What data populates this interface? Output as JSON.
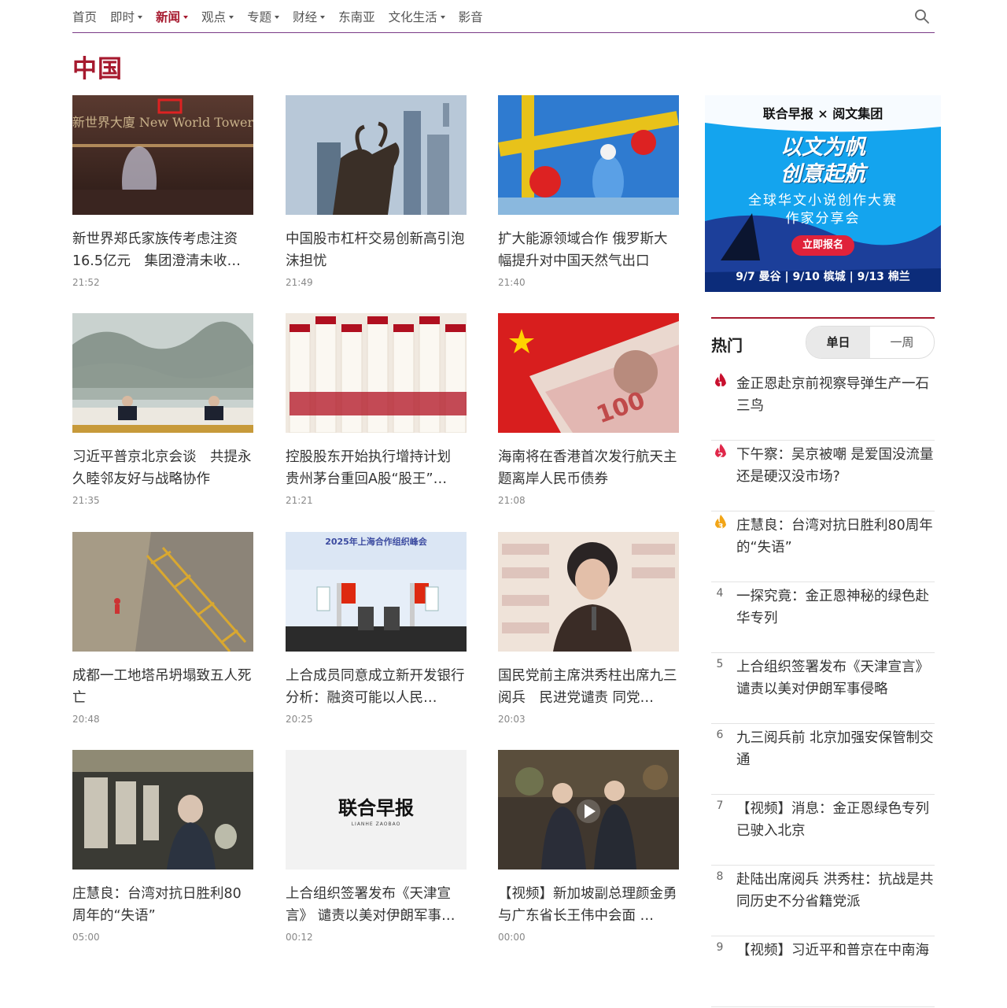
{
  "nav": {
    "items": [
      {
        "label": "首页",
        "caret": false,
        "active": false
      },
      {
        "label": "即时",
        "caret": true,
        "active": false
      },
      {
        "label": "新闻",
        "caret": true,
        "active": true
      },
      {
        "label": "观点",
        "caret": true,
        "active": false
      },
      {
        "label": "专题",
        "caret": true,
        "active": false
      },
      {
        "label": "财经",
        "caret": true,
        "active": false
      },
      {
        "label": "东南亚",
        "caret": false,
        "active": false
      },
      {
        "label": "文化生活",
        "caret": true,
        "active": false
      },
      {
        "label": "影音",
        "caret": false,
        "active": false
      }
    ],
    "search_icon": "search-icon"
  },
  "page": {
    "title": "中国"
  },
  "articles": [
    {
      "title": "新世界郑氏家族传考虑注资16.5亿元　集团澄清未收…",
      "time": "21:52",
      "image": "new-world-tower-sign",
      "image_text": "新世界大廈 New World Tower"
    },
    {
      "title": "中国股市杠杆交易创新高引泡沫担忧",
      "time": "21:49",
      "image": "bull-statue-skyscrapers"
    },
    {
      "title": "扩大能源领域合作 俄罗斯大幅提升对中国天然气出口",
      "time": "21:40",
      "image": "gas-pipeline-worker"
    },
    {
      "title": "习近平普京北京会谈　共提永久睦邻友好与战略协作",
      "time": "21:35",
      "image": "leaders-meeting"
    },
    {
      "title": "控股股东开始执行增持计划 贵州茅台重回A股“股王”…",
      "time": "21:21",
      "image": "moutai-bottles"
    },
    {
      "title": "海南将在香港首次发行航天主题离岸人民币债券",
      "time": "21:08",
      "image": "rmb-banknote-flag"
    },
    {
      "title": "成都一工地塔吊坍塌致五人死亡",
      "time": "20:48",
      "image": "collapsed-crane"
    },
    {
      "title": "上合成员同意成立新开发银行 分析：融资可能以人民…",
      "time": "20:25",
      "image": "sco-summit-press",
      "image_text": "2025年上海合作组织峰会"
    },
    {
      "title": "国民党前主席洪秀柱出席九三阅兵　民进党谴责 同党…",
      "time": "20:03",
      "image": "speaker-microphone"
    },
    {
      "title": "庄慧良：台湾对抗日胜利80周年的“失语”",
      "time": "05:00",
      "image": "exhibition-visitors"
    },
    {
      "title": "上合组织签署发布《天津宣言》 谴责以美对伊朗军事…",
      "time": "00:12",
      "image": "zaobao-logo",
      "image_text": "联合早报",
      "image_subtext": "LIANHE ZAOBAO"
    },
    {
      "title": "【视频】新加坡副总理颜金勇与广东省长王伟中会面 …",
      "time": "00:00",
      "image": "video-handshake",
      "video": true
    }
  ],
  "ad": {
    "header": "联合早报 × 阅文集团",
    "slogan_line1": "以文为帆",
    "slogan_line2": "创意起航",
    "sub_line1": "全球华文小说创作大赛",
    "sub_line2": "作家分享会",
    "button": "立即报名",
    "footer": "9/7 曼谷 | 9/10 槟城 | 9/13 棉兰",
    "bg_color": "#14a4ee"
  },
  "hot": {
    "title": "热门",
    "tabs": [
      {
        "label": "单日",
        "active": true
      },
      {
        "label": "一周",
        "active": false
      }
    ],
    "items": [
      {
        "rank": "1",
        "text": "金正恩赴京前视察导弹生产一石三鸟",
        "flame_color": "#c8102e"
      },
      {
        "rank": "2",
        "text": "下午察：吴京被嘲 是爱国没流量还是硬汉没市场?",
        "flame_color": "#e0284a"
      },
      {
        "rank": "3",
        "text": "庄慧良：台湾对抗日胜利80周年的“失语”",
        "flame_color": "#f2a516"
      },
      {
        "rank": "4",
        "text": "一探究竟：金正恩神秘的绿色赴华专列"
      },
      {
        "rank": "5",
        "text": "上合组织签署发布《天津宣言》谴责以美对伊朗军事侵略"
      },
      {
        "rank": "6",
        "text": "九三阅兵前 北京加强安保管制交通"
      },
      {
        "rank": "7",
        "text": "【视频】消息：金正恩绿色专列已驶入北京"
      },
      {
        "rank": "8",
        "text": "赴陆出席阅兵 洪秀柱：抗战是共同历史不分省籍党派"
      },
      {
        "rank": "9",
        "text": "【视频】习近平和普京在中南海"
      }
    ]
  },
  "colors": {
    "accent": "#a6192e",
    "nav_rule": "#7b3a86"
  }
}
